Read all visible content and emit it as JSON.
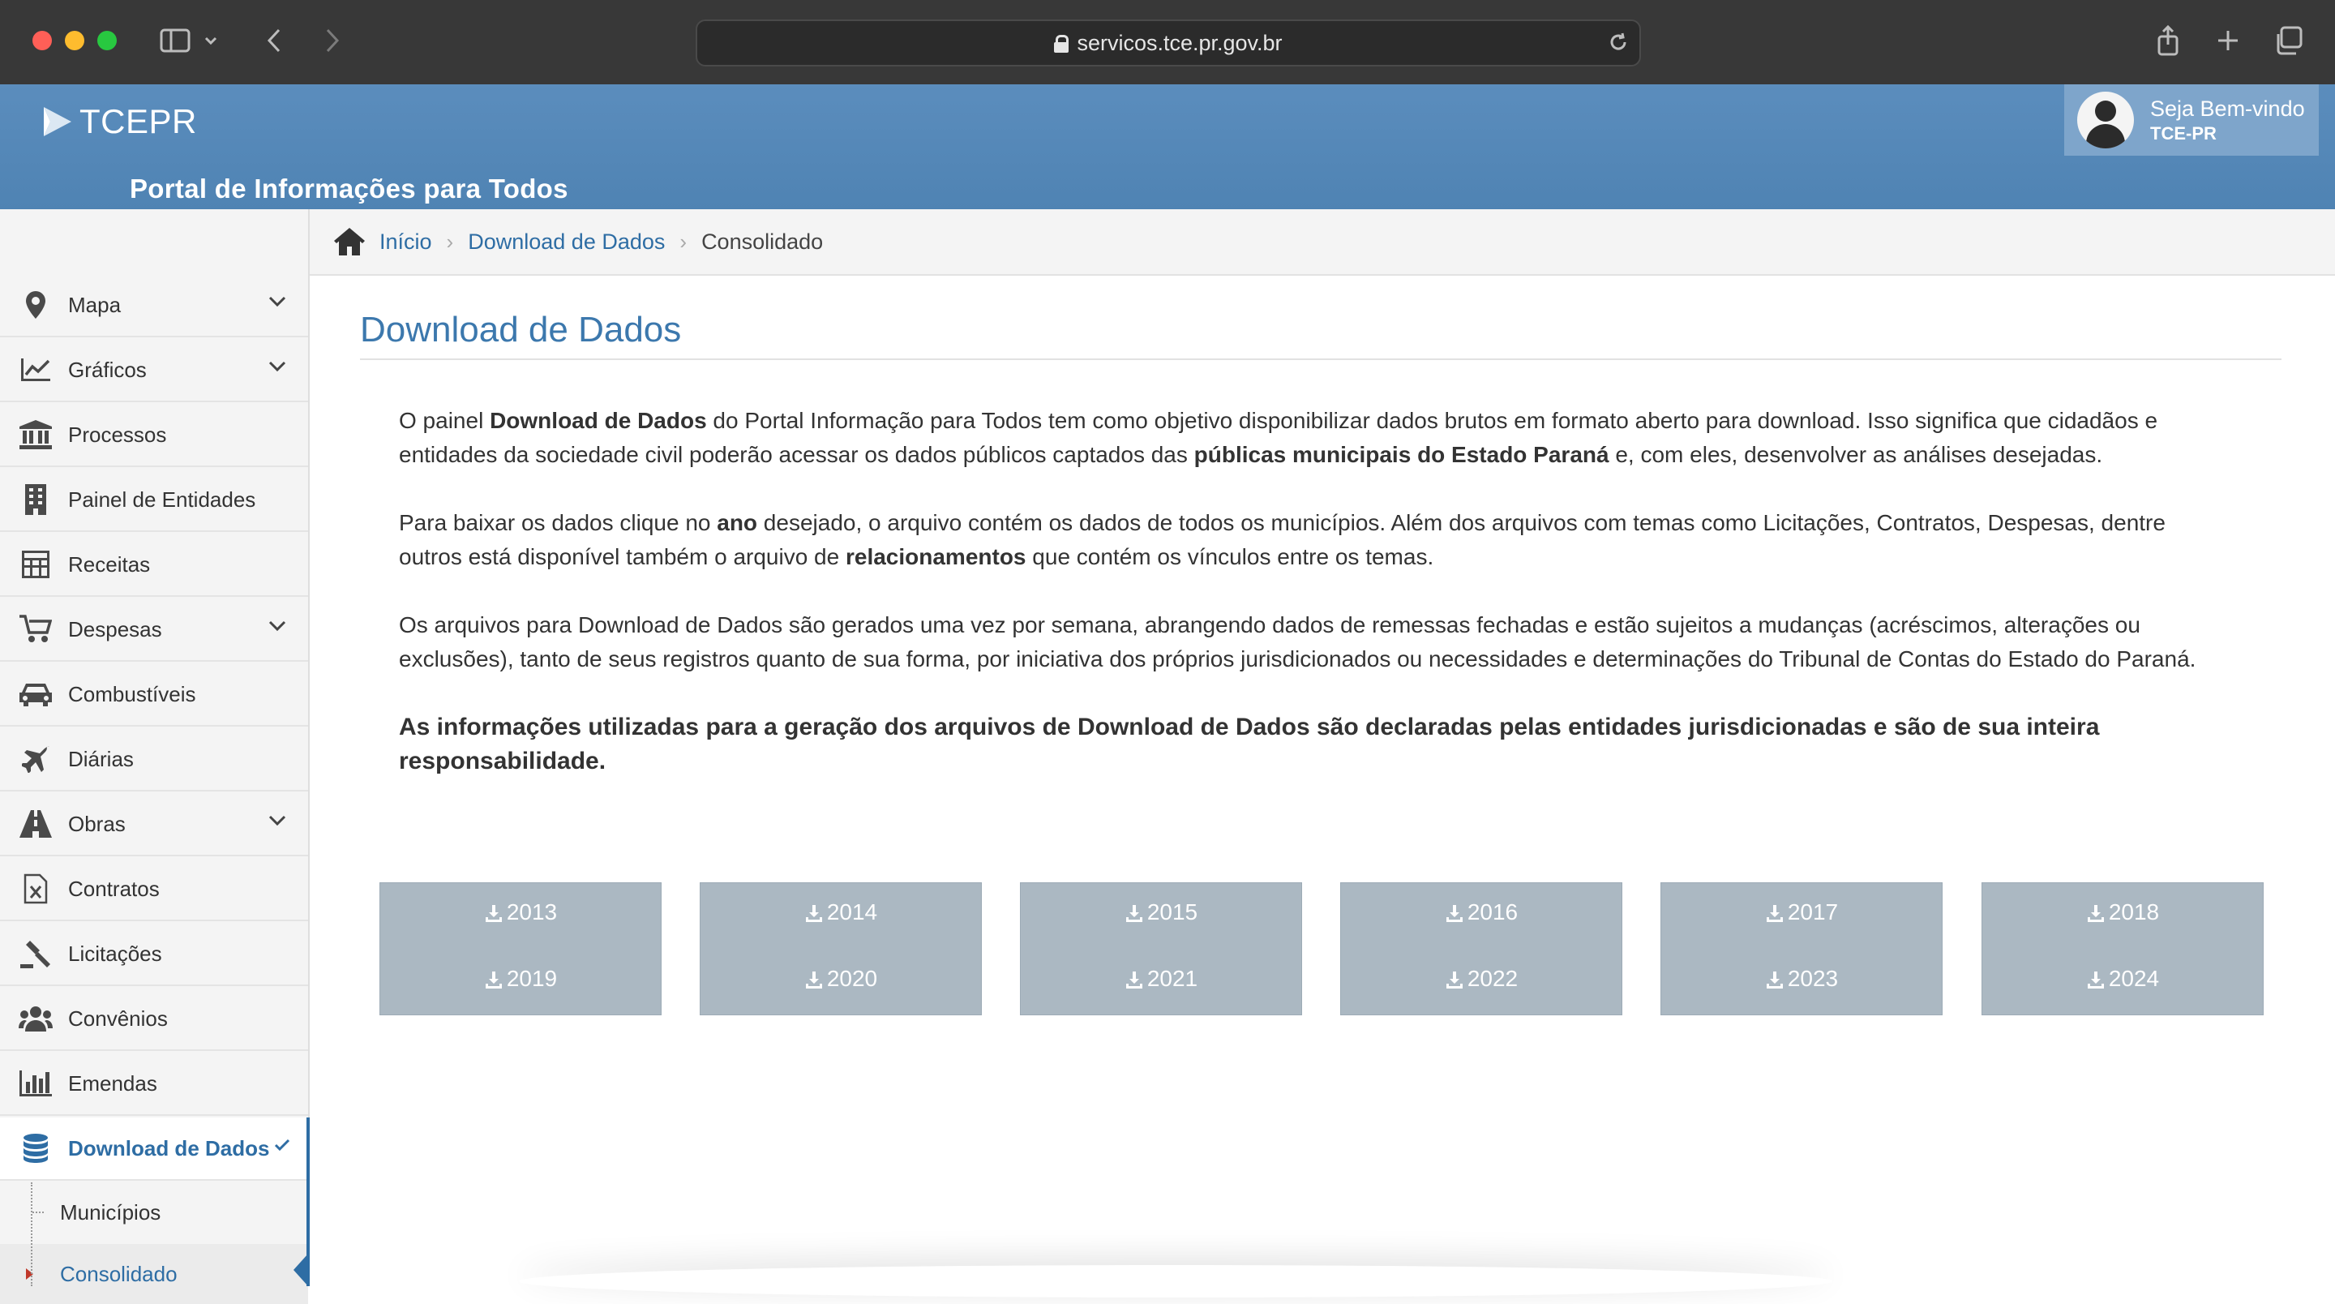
{
  "browser": {
    "url": "servicos.tce.pr.gov.br"
  },
  "header": {
    "logo_text": "TCEPR",
    "portal_title": "Portal de Informações para Todos",
    "user_greeting": "Seja Bem-vindo",
    "user_org": "TCE-PR"
  },
  "sidebar": {
    "items": [
      {
        "label": "Mapa",
        "icon": "map-pin-icon",
        "expandable": true
      },
      {
        "label": "Gráficos",
        "icon": "line-chart-icon",
        "expandable": true
      },
      {
        "label": "Processos",
        "icon": "institution-icon",
        "expandable": false
      },
      {
        "label": "Painel de Entidades",
        "icon": "building-icon",
        "expandable": false
      },
      {
        "label": "Receitas",
        "icon": "calculator-icon",
        "expandable": false
      },
      {
        "label": "Despesas",
        "icon": "cart-icon",
        "expandable": true
      },
      {
        "label": "Combustíveis",
        "icon": "car-icon",
        "expandable": false
      },
      {
        "label": "Diárias",
        "icon": "plane-icon",
        "expandable": false
      },
      {
        "label": "Obras",
        "icon": "road-icon",
        "expandable": true
      },
      {
        "label": "Contratos",
        "icon": "file-excel-icon",
        "expandable": false
      },
      {
        "label": "Licitações",
        "icon": "gavel-icon",
        "expandable": false
      },
      {
        "label": "Convênios",
        "icon": "users-icon",
        "expandable": false
      },
      {
        "label": "Emendas",
        "icon": "bar-chart-icon",
        "expandable": false
      },
      {
        "label": "Download de Dados",
        "icon": "database-icon",
        "expandable": true,
        "active": true
      }
    ],
    "subitems": [
      {
        "label": "Municípios"
      },
      {
        "label": "Consolidado",
        "active": true
      }
    ]
  },
  "breadcrumb": {
    "items": [
      "Início",
      "Download de Dados"
    ],
    "current": "Consolidado"
  },
  "main": {
    "title": "Download de Dados",
    "p1": {
      "a": "O painel ",
      "b": "Download de Dados",
      "c": " do Portal Informação para Todos tem como objetivo disponibilizar dados brutos em formato aberto para download. Isso significa que cidadãos e entidades da sociedade civil poderão acessar os dados públicos captados das ",
      "d": "públicas municipais do Estado Paraná",
      "e": " e, com eles, desenvolver as análises desejadas."
    },
    "p2": {
      "a": "Para baixar os dados clique no ",
      "b": "ano",
      "c": " desejado, o arquivo contém os dados de todos os municípios. Além dos arquivos com temas como Licitações, Contratos, Despesas, dentre outros está disponível também o arquivo de ",
      "d": "relacionamentos",
      "e": " que contém os vínculos entre os temas."
    },
    "p3": "Os arquivos para Download de Dados são gerados uma vez por semana, abrangendo dados de remessas fechadas e estão sujeitos a mudanças (acréscimos, alterações ou exclusões), tanto de seus registros quanto de sua forma, por iniciativa dos próprios jurisdicionados ou necessidades e determinações do Tribunal de Contas do Estado do Paraná.",
    "p4": "As informações utilizadas para a geração dos arquivos de Download de Dados são declaradas pelas entidades jurisdicionadas e são de sua inteira responsabilidade.",
    "years": [
      [
        "2013",
        "2019"
      ],
      [
        "2014",
        "2020"
      ],
      [
        "2015",
        "2021"
      ],
      [
        "2016",
        "2022"
      ],
      [
        "2017",
        "2023"
      ],
      [
        "2018",
        "2024"
      ]
    ]
  },
  "colors": {
    "header_blue": "#5289b9",
    "link_blue": "#2e6da4",
    "year_box": "#abb8c2"
  }
}
